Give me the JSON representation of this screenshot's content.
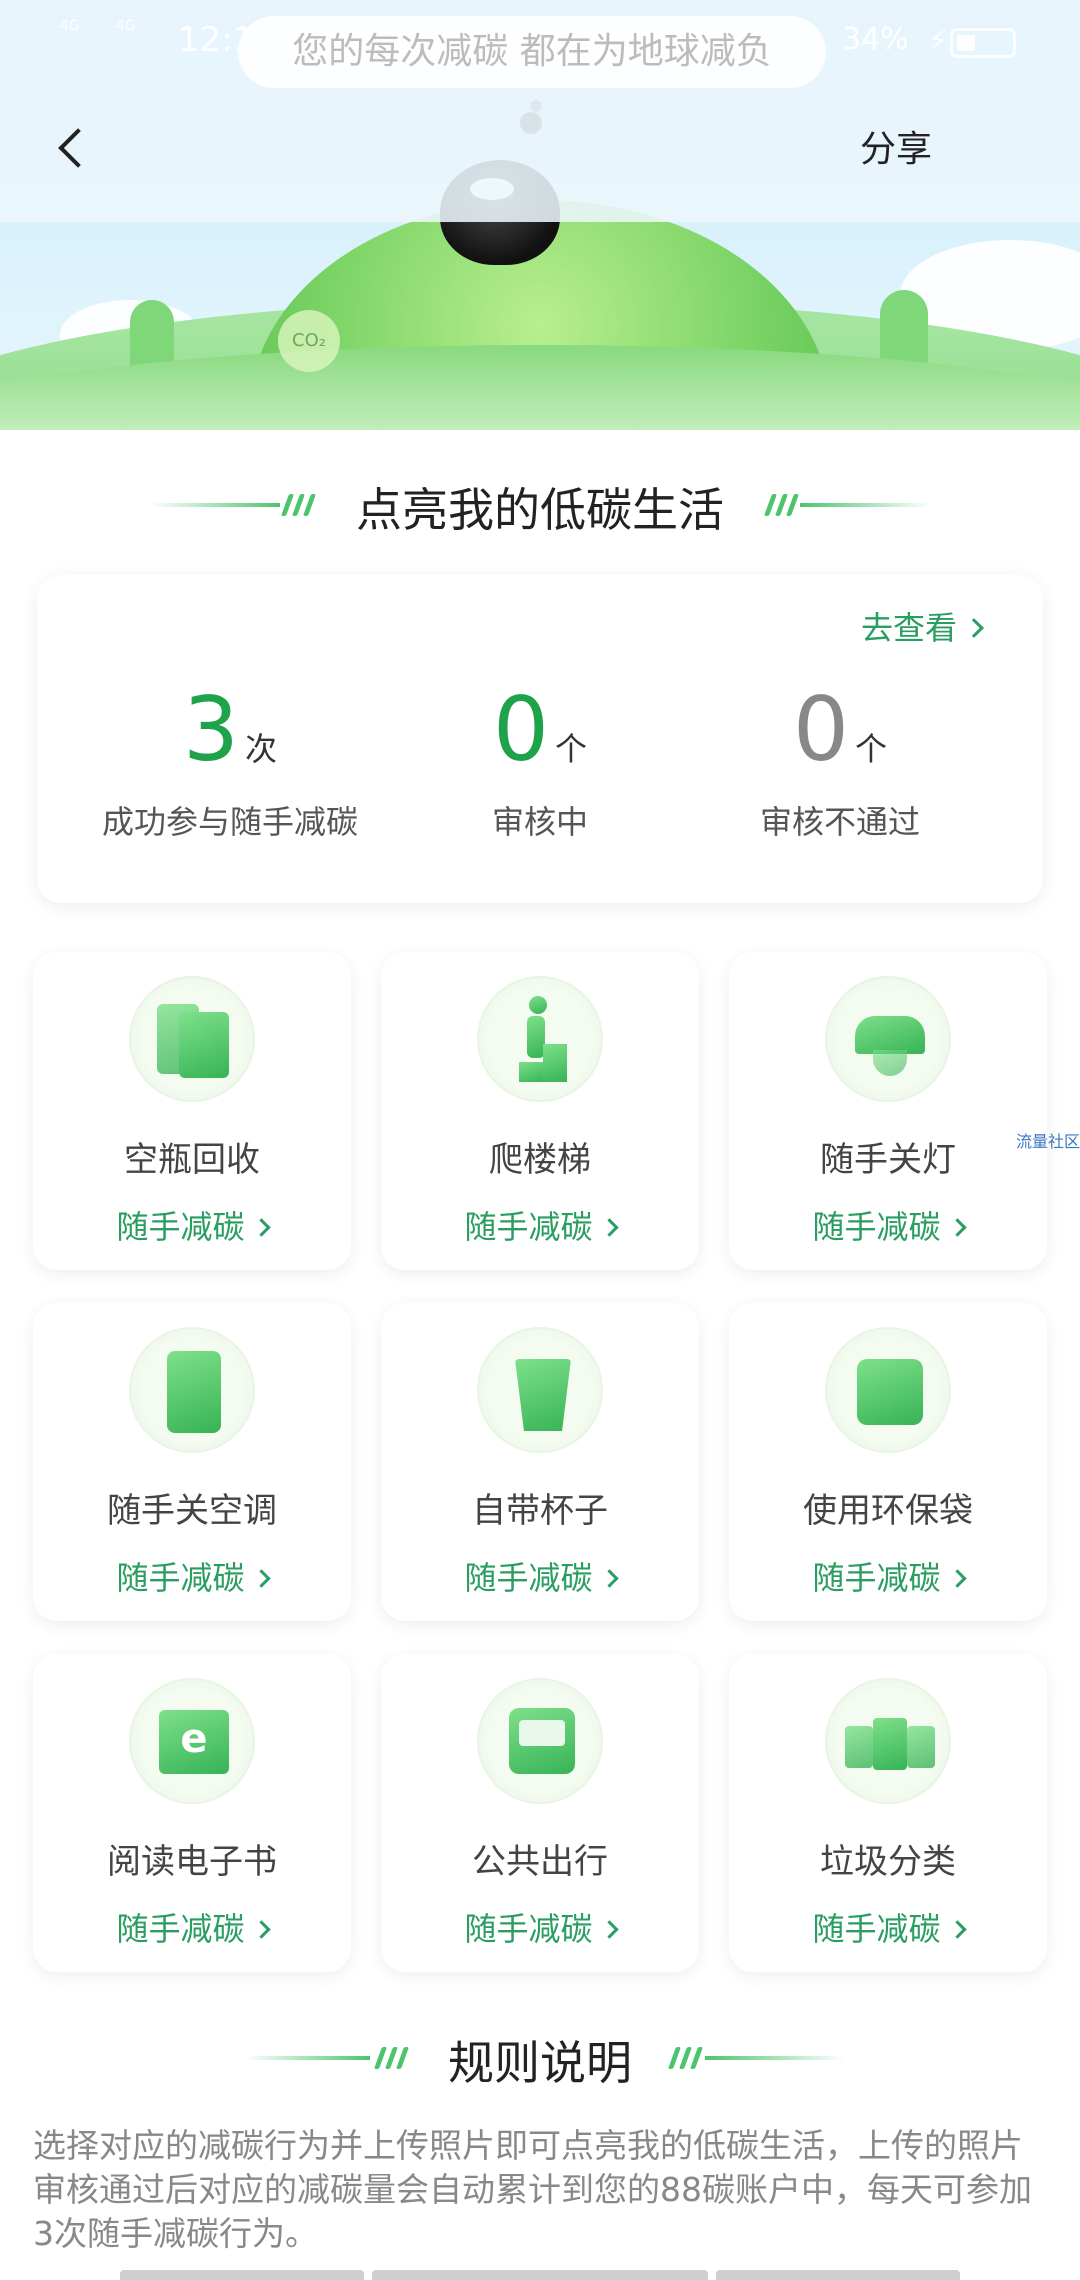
{
  "status_bar": {
    "signal_1": "4G",
    "signal_2": "4G",
    "time": "12:1",
    "battery": "34%"
  },
  "slogan": "您的每次减碳 都在为地球减负",
  "nav": {
    "share": "分享"
  },
  "hero": {
    "co2": "CO₂"
  },
  "section_title": "点亮我的低碳生活",
  "stats": {
    "view_link": "去查看",
    "items": [
      {
        "value": "3",
        "unit": "次",
        "label": "成功参与随手减碳",
        "color": "#1fa34a"
      },
      {
        "value": "0",
        "unit": "个",
        "label": "审核中",
        "color": "#1fa34a"
      },
      {
        "value": "0",
        "unit": "个",
        "label": "审核不通过",
        "color": "#888888"
      }
    ]
  },
  "activities": [
    {
      "name": "空瓶回收",
      "action": "随手减碳",
      "icon": "recycle-bag-icon"
    },
    {
      "name": "爬楼梯",
      "action": "随手减碳",
      "icon": "stairs-icon"
    },
    {
      "name": "随手关灯",
      "action": "随手减碳",
      "icon": "lamp-icon"
    },
    {
      "name": "随手关空调",
      "action": "随手减碳",
      "icon": "air-conditioner-icon"
    },
    {
      "name": "自带杯子",
      "action": "随手减碳",
      "icon": "cup-icon"
    },
    {
      "name": "使用环保袋",
      "action": "随手减碳",
      "icon": "eco-bag-icon"
    },
    {
      "name": "阅读电子书",
      "action": "随手减碳",
      "icon": "ebook-icon"
    },
    {
      "name": "公共出行",
      "action": "随手减碳",
      "icon": "bus-icon"
    },
    {
      "name": "垃圾分类",
      "action": "随手减碳",
      "icon": "trash-bins-icon"
    }
  ],
  "side_tag": "流量社区",
  "rules": {
    "title": "规则说明",
    "text": "选择对应的减碳行为并上传照片即可点亮我的低碳生活，上传的照片审核通过后对应的减碳量会自动累计到您的88碳账户中，每天可参加3次随手减碳行为。"
  },
  "colors": {
    "accent": "#2a9d61",
    "count_green": "#1fa34a",
    "icon_green": "#37b356"
  }
}
